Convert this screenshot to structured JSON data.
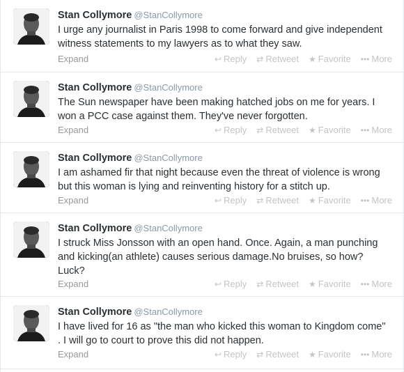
{
  "tweets": [
    {
      "fullname": "Stan Collymore",
      "username": "@StanCollymore",
      "text": "I urge any journalist in Paris 1998 to come forward and give independent witness statements to my lawyers as to what they saw.",
      "expand": "Expand"
    },
    {
      "fullname": "Stan Collymore",
      "username": "@StanCollymore",
      "text": "The Sun newspaper have been making hatched jobs on me for years. I won a PCC case against them. They've never forgotten.",
      "expand": "Expand"
    },
    {
      "fullname": "Stan Collymore",
      "username": "@StanCollymore",
      "text": "I am ashamed fir that night because even the threat of violence is wrong but this woman is lying and reinventing history for a stitch up.",
      "expand": "Expand"
    },
    {
      "fullname": "Stan Collymore",
      "username": "@StanCollymore",
      "text": "I struck Miss Jonsson with an open hand. Once. Again, a man punching and kicking(an athlete) causes serious damage.No bruises, so how? Luck?",
      "expand": "Expand"
    },
    {
      "fullname": "Stan Collymore",
      "username": "@StanCollymore",
      "text": "I have lived for 16 as \"the man who kicked this woman to Kingdom come\" . I will go to court to prove this did not happen.",
      "expand": "Expand"
    }
  ],
  "actions": {
    "reply": "Reply",
    "retweet": "Retweet",
    "favorite": "Favorite",
    "more": "More"
  },
  "icons": {
    "reply": "reply-icon",
    "retweet": "retweet-icon",
    "favorite": "star-icon",
    "more": "ellipsis-icon"
  },
  "colors": {
    "name": "#292f33",
    "username": "#8899a6",
    "muted": "#999999",
    "action": "#c4c4c4"
  }
}
